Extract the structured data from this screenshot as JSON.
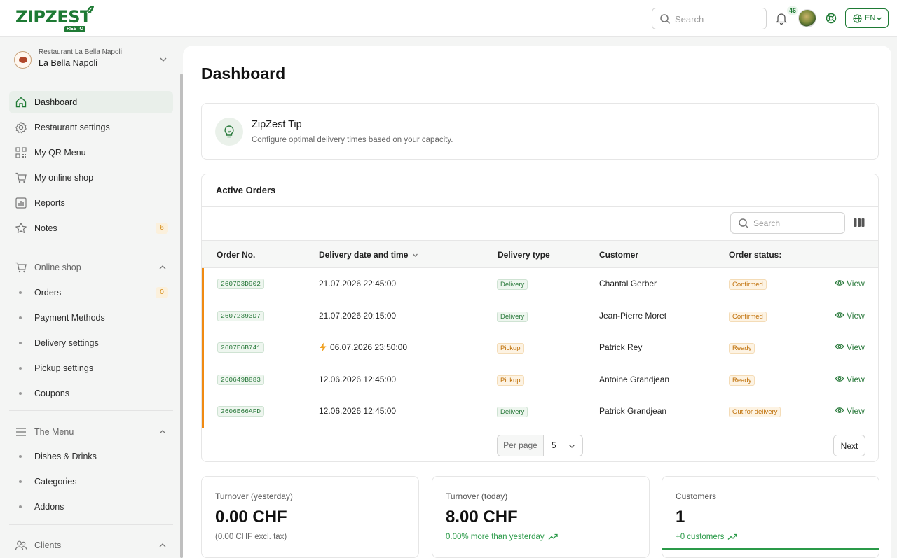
{
  "brand": {
    "name": "ZIPZEST",
    "badge": "RESTO"
  },
  "header": {
    "search_placeholder": "Search",
    "notifications_count": "46",
    "language": "EN"
  },
  "restaurant": {
    "subtitle": "Restaurant La Bella Napoli",
    "name": "La Bella Napoli"
  },
  "sidebar": {
    "main_items": [
      {
        "label": "Dashboard",
        "icon": "home-icon",
        "active": true
      },
      {
        "label": "Restaurant settings",
        "icon": "gear-icon"
      },
      {
        "label": "My QR Menu",
        "icon": "qr-code-icon"
      },
      {
        "label": "My online shop",
        "icon": "cart-icon"
      },
      {
        "label": "Reports",
        "icon": "chart-icon"
      },
      {
        "label": "Notes",
        "icon": "star-icon",
        "badge": "6"
      }
    ],
    "online_shop": {
      "label": "Online shop",
      "items": [
        {
          "label": "Orders",
          "badge": "0"
        },
        {
          "label": "Payment Methods"
        },
        {
          "label": "Delivery settings"
        },
        {
          "label": "Pickup settings"
        },
        {
          "label": "Coupons"
        }
      ]
    },
    "menu": {
      "label": "The Menu",
      "items": [
        {
          "label": "Dishes & Drinks"
        },
        {
          "label": "Categories"
        },
        {
          "label": "Addons"
        }
      ]
    },
    "clients": {
      "label": "Clients"
    }
  },
  "page": {
    "title": "Dashboard"
  },
  "tip": {
    "title": "ZipZest Tip",
    "text": "Configure optimal delivery times based on your capacity."
  },
  "orders": {
    "title": "Active Orders",
    "search_placeholder": "Search",
    "columns": [
      "Order No.",
      "Delivery date and time",
      "Delivery type",
      "Customer",
      "Order status:"
    ],
    "rows": [
      {
        "order_no": "2607D3D902",
        "datetime": "21.07.2026 22:45:00",
        "type": "Delivery",
        "customer": "Chantal Gerber",
        "status": "Confirmed",
        "action": "View",
        "urgent": false
      },
      {
        "order_no": "26072393D7",
        "datetime": "21.07.2026 20:15:00",
        "type": "Delivery",
        "customer": "Jean-Pierre Moret",
        "status": "Confirmed",
        "action": "View",
        "urgent": false
      },
      {
        "order_no": "2607E6B741",
        "datetime": "06.07.2026 23:50:00",
        "type": "Pickup",
        "customer": "Patrick Rey",
        "status": "Ready",
        "action": "View",
        "urgent": true
      },
      {
        "order_no": "260649B883",
        "datetime": "12.06.2026 12:45:00",
        "type": "Pickup",
        "customer": "Antoine Grandjean",
        "status": "Ready",
        "action": "View",
        "urgent": false
      },
      {
        "order_no": "2606E66AFD",
        "datetime": "12.06.2026 12:45:00",
        "type": "Delivery",
        "customer": "Patrick Grandjean",
        "status": "Out for delivery",
        "action": "View",
        "urgent": false
      }
    ],
    "per_page_label": "Per page",
    "per_page_value": "5",
    "next_label": "Next"
  },
  "stats": [
    {
      "label": "Turnover (yesterday)",
      "value": "0.00 CHF",
      "sub": "(0.00 CHF excl. tax)",
      "positive": false
    },
    {
      "label": "Turnover (today)",
      "value": "8.00 CHF",
      "sub": "0.00% more than yesterday",
      "positive": true
    },
    {
      "label": "Customers",
      "value": "1",
      "sub": "+0 customers",
      "positive": true
    }
  ],
  "colors": {
    "brand_green": "#1e7a34",
    "accent_orange": "#f08a12",
    "positive_green": "#2a9a48"
  }
}
